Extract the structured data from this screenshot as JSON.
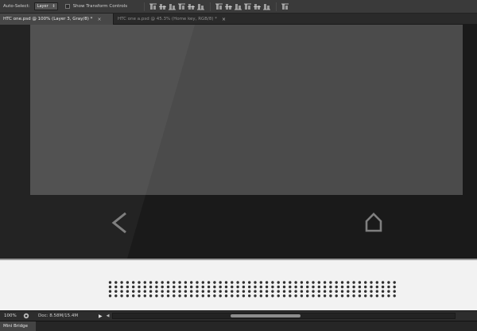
{
  "options_bar": {
    "auto_select_label": "Auto-Select:",
    "auto_select_value": "Layer",
    "show_transform_label": "Show Transform Controls",
    "show_transform_checked": false,
    "tool_icons": [
      "align-top-icon",
      "align-vertical-center-icon",
      "align-bottom-icon",
      "align-left-icon",
      "align-horizontal-center-icon",
      "align-right-icon",
      "distribute-top-icon",
      "distribute-vertical-center-icon",
      "distribute-bottom-icon",
      "distribute-left-icon",
      "distribute-horizontal-center-icon",
      "distribute-right-icon",
      "auto-align-layers-icon"
    ]
  },
  "tabs": [
    {
      "label": "HTC one.psd @ 100% (Layer 3, Gray/8) *",
      "active": true
    },
    {
      "label": "HTC one a.psd @ 45.3% (Home key, RGB/8) *",
      "active": false
    }
  ],
  "canvas": {
    "nav_icons": [
      "back-arrow-icon",
      "home-icon"
    ],
    "colors": {
      "bezel": "#1a1a1a",
      "screen": "#4b4b4b",
      "body": "#f2f2f2",
      "grille_dot": "#2f2f2f"
    }
  },
  "status_bar": {
    "zoom": "100%",
    "doc_info": "Doc: 8.58M/15.4M",
    "scroll_position": 0.43
  },
  "panel": {
    "tab_label": "Mini Bridge"
  }
}
